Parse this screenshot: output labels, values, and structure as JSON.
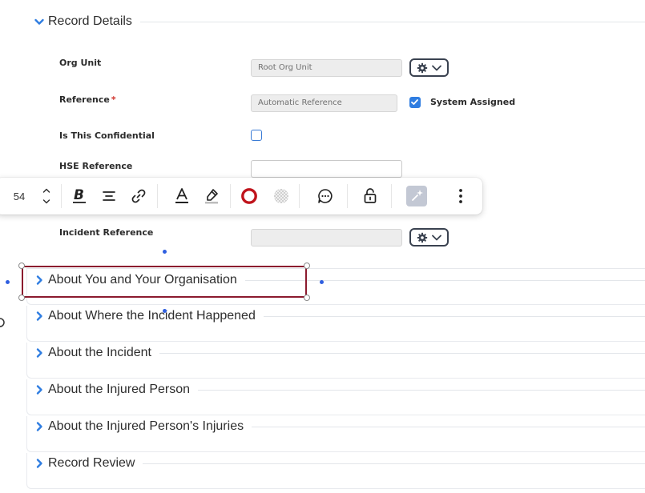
{
  "record_details": {
    "title": "Record Details",
    "org_unit": {
      "label": "Org Unit",
      "value": "Root Org Unit"
    },
    "reference": {
      "label": "Reference",
      "required_mark": "*",
      "value": "Automatic Reference",
      "system_assigned_label": "System Assigned",
      "system_assigned": true
    },
    "confidential": {
      "label": "Is This Confidential",
      "checked": false
    },
    "hse_reference": {
      "label": "HSE Reference",
      "value": ""
    },
    "incident_reference": {
      "label": "Incident Reference",
      "value": ""
    }
  },
  "toolbar": {
    "font_size": "54",
    "icons": [
      "stepper-icon",
      "bold-icon",
      "align-center-icon",
      "link-icon",
      "text-color-icon",
      "highlighter-icon",
      "border-color-icon",
      "transparency-icon",
      "comment-icon",
      "unlock-icon",
      "magic-wand-icon",
      "more-vertical-icon"
    ],
    "border_color": "#c0141c"
  },
  "sections": [
    {
      "title": "About You and Your Organisation"
    },
    {
      "title": "About Where the Incident Happened"
    },
    {
      "title": "About the Incident"
    },
    {
      "title": "About the Injured Person"
    },
    {
      "title": "About the Injured Person's Injuries"
    },
    {
      "title": "Record Review"
    }
  ],
  "colors": {
    "accent": "#2f7de1",
    "selection": "#8b1a2e",
    "handle_dot": "#2f5fe0"
  }
}
